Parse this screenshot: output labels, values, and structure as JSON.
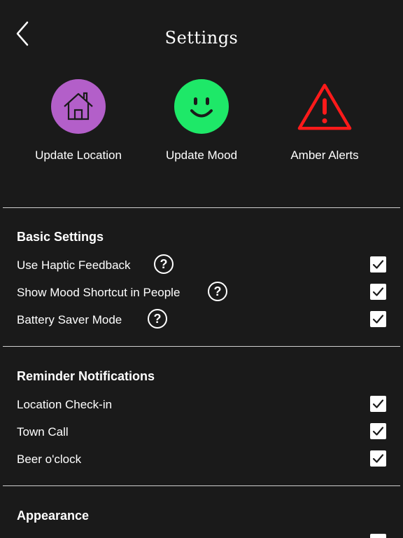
{
  "header": {
    "title": "Settings",
    "back_icon": "chevron-left-icon"
  },
  "quick_actions": [
    {
      "label": "Update Location",
      "icon": "home-icon",
      "color": "#b35fc9"
    },
    {
      "label": "Update Mood",
      "icon": "smiley-icon",
      "color": "#1ee868"
    },
    {
      "label": "Amber Alerts",
      "icon": "warning-icon",
      "color": "#ff1a1a"
    }
  ],
  "sections": {
    "basic": {
      "title": "Basic Settings",
      "items": [
        {
          "label": "Use Haptic Feedback",
          "checked": true,
          "help": "?"
        },
        {
          "label": "Show Mood Shortcut in People",
          "checked": true,
          "help": "?"
        },
        {
          "label": "Battery Saver Mode",
          "checked": true,
          "help": "?"
        }
      ]
    },
    "reminders": {
      "title": "Reminder Notifications",
      "items": [
        {
          "label": "Location Check-in",
          "checked": true
        },
        {
          "label": "Town Call",
          "checked": true
        },
        {
          "label": "Beer o'clock",
          "checked": true
        }
      ]
    },
    "appearance": {
      "title": "Appearance"
    }
  },
  "colors": {
    "background": "#1a1a1a",
    "text": "#ffffff",
    "divider": "#cfcfcf"
  }
}
